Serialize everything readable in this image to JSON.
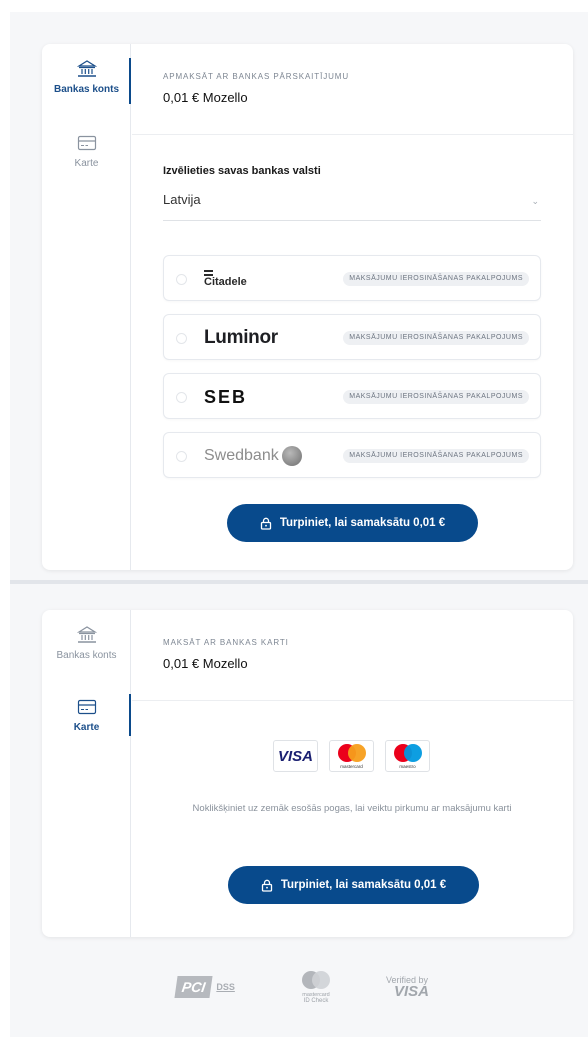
{
  "colors": {
    "accent": "#084a8c",
    "muted": "#8a939f"
  },
  "sidebar": {
    "bank_label": "Bankas konts",
    "card_label": "Karte"
  },
  "bank_transfer": {
    "kicker": "APMAKSĀT AR BANKAS PĀRSKAITĪJUMU",
    "amount": "0,01 € Mozello",
    "country_label": "Izvēlieties savas bankas valsti",
    "country_value": "Latvija",
    "banks": [
      {
        "name": "Citadele",
        "badge": "MAKSĀJUMU IEROSINĀŠANAS PAKALPOJUMS"
      },
      {
        "name": "Luminor",
        "badge": "MAKSĀJUMU IEROSINĀŠANAS PAKALPOJUMS"
      },
      {
        "name": "SEB",
        "badge": "MAKSĀJUMU IEROSINĀŠANAS PAKALPOJUMS"
      },
      {
        "name": "Swedbank",
        "badge": "MAKSĀJUMU IEROSINĀŠANAS PAKALPOJUMS"
      }
    ],
    "button_label": "Turpiniet, lai samaksātu 0,01 €"
  },
  "card_payment": {
    "kicker": "MAKSĀT AR BANKAS KARTI",
    "amount": "0,01 € Mozello",
    "brands": [
      "VISA",
      "mastercard",
      "maestro"
    ],
    "note": "Noklikšķiniet uz zemāk esošās pogas, lai veiktu pirkumu ar maksājumu karti",
    "button_label": "Turpiniet, lai samaksātu 0,01 €"
  },
  "trust": {
    "pci": "PCI",
    "dss": "DSS",
    "mc_line1": "mastercard",
    "mc_line2": "ID Check",
    "verified_by": "Verified by",
    "visa": "VISA"
  }
}
